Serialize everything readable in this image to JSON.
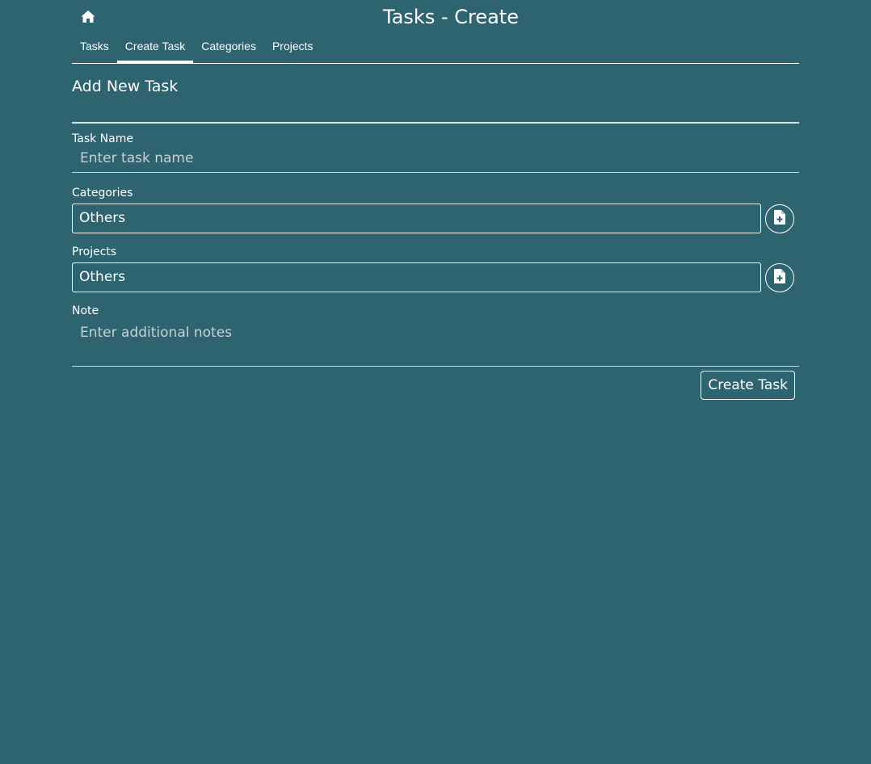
{
  "header": {
    "title": "Tasks - Create",
    "home_icon": "home-icon"
  },
  "tabs": [
    {
      "label": "Tasks",
      "active": false
    },
    {
      "label": "Create Task",
      "active": true
    },
    {
      "label": "Categories",
      "active": false
    },
    {
      "label": "Projects",
      "active": false
    }
  ],
  "form": {
    "heading": "Add New Task",
    "task_name": {
      "label": "Task Name",
      "value": "",
      "placeholder": "Enter task name"
    },
    "categories": {
      "label": "Categories",
      "selected": "Others",
      "add_icon": "file-plus-icon"
    },
    "projects": {
      "label": "Projects",
      "selected": "Others",
      "add_icon": "file-plus-icon"
    },
    "note": {
      "label": "Note",
      "value": "",
      "placeholder": "Enter additional notes"
    },
    "submit_label": "Create Task"
  },
  "colors": {
    "background": "#2e6370",
    "foreground": "#ffffff"
  }
}
